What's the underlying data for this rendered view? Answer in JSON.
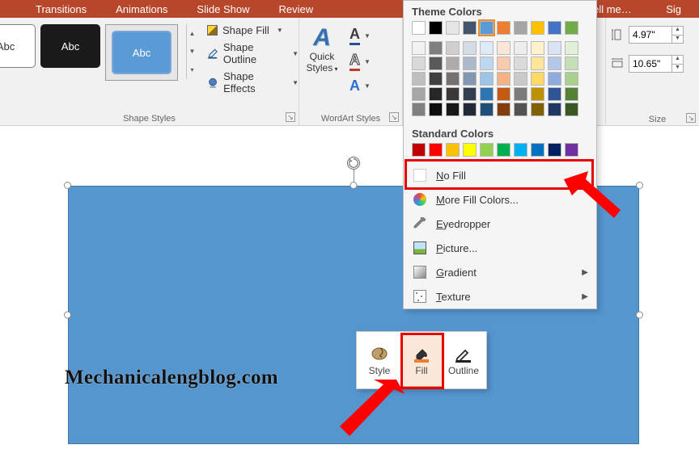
{
  "tabs": {
    "transitions": "Transitions",
    "animations": "Animations",
    "slideshow": "Slide Show",
    "review": "Review",
    "tellme": "ell me…",
    "sign": "Sig"
  },
  "shapeStyles": {
    "label": "Shape Styles",
    "previewText": "Abc",
    "fill": "Shape Fill",
    "outline": "Shape Outline",
    "effects": "Shape Effects"
  },
  "wordart": {
    "label": "WordArt Styles",
    "quick": "Quick Styles"
  },
  "size": {
    "label": "Size",
    "height": "4.97\"",
    "width": "10.65\""
  },
  "colorPanel": {
    "theme": "Theme Colors",
    "standard": "Standard Colors",
    "nofill": "No Fill",
    "more": "More Fill Colors...",
    "eyedropper": "Eyedropper",
    "picture": "Picture...",
    "gradient": "Gradient",
    "texture": "Texture",
    "themeColors": [
      "#ffffff",
      "#000000",
      "#595959",
      "#4472c4",
      "#5b9bd5",
      "#ed7d31",
      "#a5a5a5",
      "#ffc000",
      "#4472c4",
      "#70ad47"
    ],
    "standardColors": [
      "#c00000",
      "#ff0000",
      "#ffc000",
      "#ffff00",
      "#92d050",
      "#00b050",
      "#00b0f0",
      "#0070c0",
      "#002060",
      "#7030a0"
    ]
  },
  "miniToolbar": {
    "style": "Style",
    "fill": "Fill",
    "outline": "Outline"
  },
  "watermark": "Mechanicalengblog.com"
}
